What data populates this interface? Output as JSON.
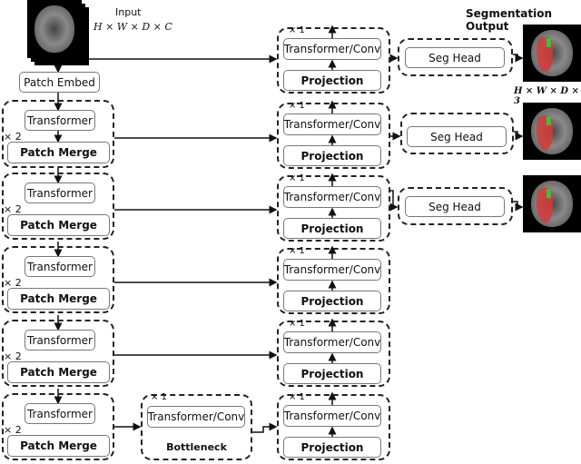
{
  "input": {
    "label": "Input",
    "dims": "H × W × D × C"
  },
  "output": {
    "title": "Segmentation Output",
    "dims": "H × W × D × 3"
  },
  "patch_embed": "Patch Embed",
  "encoder": {
    "repeat": "× 2",
    "transformer": "Transformer",
    "merge": "Patch Merge",
    "stages": 5
  },
  "bottleneck": {
    "repeat": "× 1",
    "block": "Transformer/Conv",
    "label": "Bottleneck"
  },
  "decoder": {
    "repeat": "× 1",
    "block": "Transformer/Conv",
    "projection": "Projection",
    "stages": 6
  },
  "seg_head": "Seg Head",
  "colors": {
    "tumor": "#d33a3a",
    "core": "#3fbf3f"
  }
}
